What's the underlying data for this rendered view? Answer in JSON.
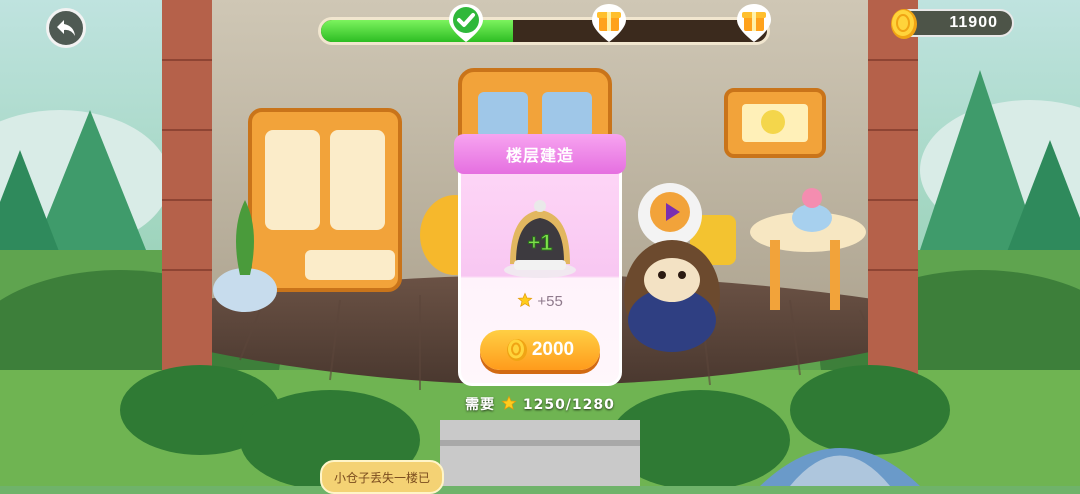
{
  "hud": {
    "back_icon": "back-arrow-icon",
    "progress": {
      "fraction": 0.43,
      "milestones": [
        {
          "state": "completed",
          "icon": "checkmark-icon"
        },
        {
          "state": "locked",
          "icon": "gift-box-icon"
        },
        {
          "state": "locked",
          "icon": "gift-box-icon"
        }
      ]
    },
    "coins": "11900",
    "coin_icon": "gold-coin-icon"
  },
  "card": {
    "title": "楼层建造",
    "item_icon": "floor-bell-plus-one-icon",
    "item_badge": "+1",
    "star_gain": "+55",
    "price": "2000",
    "price_icon": "coin-icon",
    "require_label": "需要",
    "require_value": "1250/1280"
  },
  "task_tag": {
    "text": "小仓子丢失一楼已"
  },
  "colors": {
    "progress_fill": "#2dbd23",
    "card_header": "#e56fe0",
    "buy_button": "#ff9b1c"
  }
}
